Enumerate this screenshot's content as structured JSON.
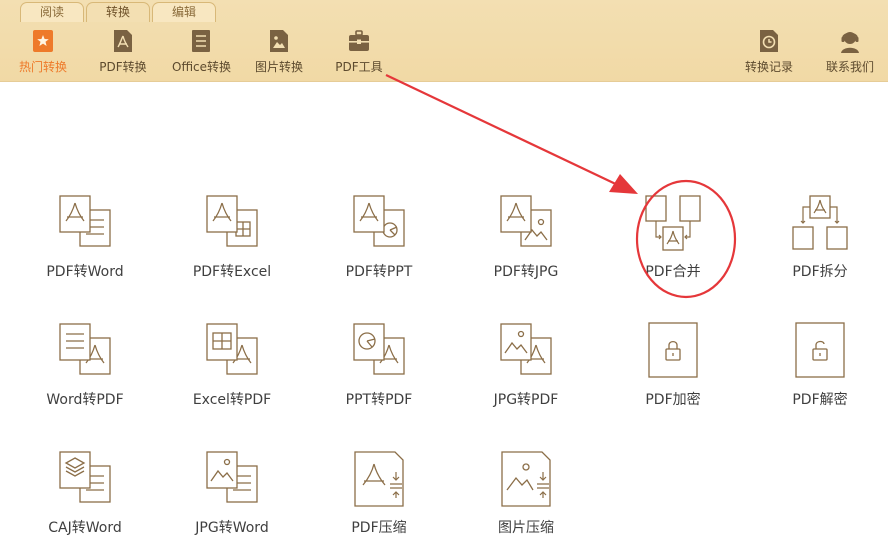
{
  "tabs": [
    {
      "label": "阅读"
    },
    {
      "label": "转换"
    },
    {
      "label": "编辑"
    }
  ],
  "toolbar": {
    "items": [
      {
        "label": "热门转换",
        "icon": "star-doc-icon",
        "active": true
      },
      {
        "label": "PDF转换",
        "icon": "pdf-doc-icon"
      },
      {
        "label": "Office转换",
        "icon": "office-doc-icon"
      },
      {
        "label": "图片转换",
        "icon": "image-doc-icon"
      },
      {
        "label": "PDF工具",
        "icon": "toolbox-icon"
      }
    ],
    "right": [
      {
        "label": "转换记录",
        "icon": "history-icon"
      },
      {
        "label": "联系我们",
        "icon": "support-agent-icon"
      }
    ]
  },
  "grid": {
    "rows": [
      [
        {
          "label": "PDF转Word",
          "icon": "pdf-to-word-icon"
        },
        {
          "label": "PDF转Excel",
          "icon": "pdf-to-excel-icon"
        },
        {
          "label": "PDF转PPT",
          "icon": "pdf-to-ppt-icon"
        },
        {
          "label": "PDF转JPG",
          "icon": "pdf-to-jpg-icon"
        },
        {
          "label": "PDF合并",
          "icon": "pdf-merge-icon"
        },
        {
          "label": "PDF拆分",
          "icon": "pdf-split-icon"
        }
      ],
      [
        {
          "label": "Word转PDF",
          "icon": "word-to-pdf-icon"
        },
        {
          "label": "Excel转PDF",
          "icon": "excel-to-pdf-icon"
        },
        {
          "label": "PPT转PDF",
          "icon": "ppt-to-pdf-icon"
        },
        {
          "label": "JPG转PDF",
          "icon": "jpg-to-pdf-icon"
        },
        {
          "label": "PDF加密",
          "icon": "pdf-encrypt-icon"
        },
        {
          "label": "PDF解密",
          "icon": "pdf-decrypt-icon"
        }
      ],
      [
        {
          "label": "CAJ转Word",
          "icon": "caj-to-word-icon"
        },
        {
          "label": "JPG转Word",
          "icon": "jpg-to-word-icon"
        },
        {
          "label": "PDF压缩",
          "icon": "pdf-compress-icon"
        },
        {
          "label": "图片压缩",
          "icon": "image-compress-icon"
        }
      ]
    ]
  },
  "colors": {
    "toolbar_bg": "#f2dcab",
    "icon_stroke": "#8b6e48",
    "toolbar_icon": "#7a6242",
    "active_accent": "#ee7a2a",
    "annotation_red": "#e5373a"
  }
}
